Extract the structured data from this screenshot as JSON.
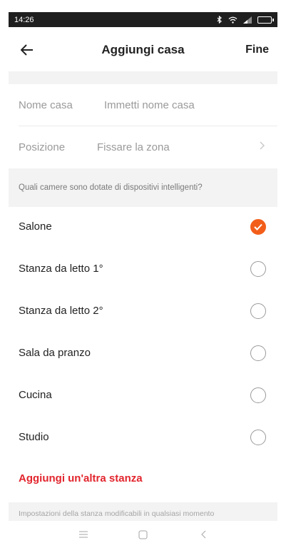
{
  "status_bar": {
    "time": "14:26"
  },
  "header": {
    "title": "Aggiungi casa",
    "done_label": "Fine"
  },
  "form": {
    "name": {
      "label": "Nome casa",
      "placeholder": "Immetti nome casa"
    },
    "location": {
      "label": "Posizione",
      "value": "Fissare la zona"
    }
  },
  "rooms_prompt": "Quali camere sono dotate di dispositivi intelligenti?",
  "rooms": [
    {
      "label": "Salone",
      "selected": true
    },
    {
      "label": "Stanza da letto 1°",
      "selected": false
    },
    {
      "label": "Stanza da letto 2°",
      "selected": false
    },
    {
      "label": "Sala da pranzo",
      "selected": false
    },
    {
      "label": "Cucina",
      "selected": false
    },
    {
      "label": "Studio",
      "selected": false
    }
  ],
  "add_room_label": "Aggiungi un'altra stanza",
  "footer_note": "Impostazioni della stanza modificabili in qualsiasi momento",
  "colors": {
    "accent": "#f25e1a",
    "link": "#e2252d"
  },
  "icons": [
    "bluetooth-icon",
    "wifi-icon",
    "signal-icon",
    "battery-icon",
    "back-arrow-icon",
    "chevron-right-icon",
    "check-icon",
    "menu-icon",
    "home-icon",
    "back-icon"
  ]
}
